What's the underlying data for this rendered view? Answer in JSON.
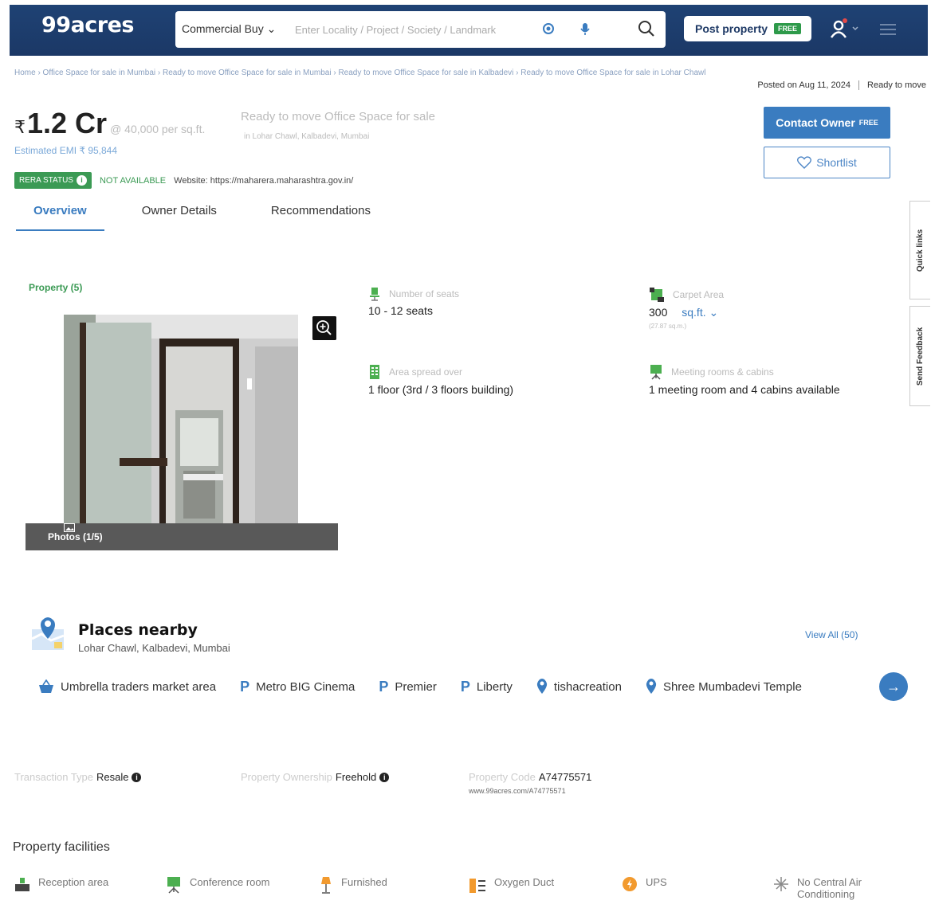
{
  "header": {
    "logo": "99acres",
    "search_category": "Commercial Buy",
    "search_placeholder": "Enter Locality / Project / Society / Landmark",
    "post_property": "Post property",
    "free_badge": "FREE"
  },
  "breadcrumb": "Home › Office Space for sale in Mumbai › Ready to move Office Space for sale in Mumbai › Ready to move Office Space for sale in Kalbadevi › Ready to move Office Space for sale in Lohar Chawl",
  "posted": {
    "date": "Posted on Aug 11, 2024",
    "status": "Ready to move"
  },
  "listing": {
    "currency": "₹",
    "price": "1.2 Cr",
    "per_sqft": "@ 40,000 per sq.ft.",
    "emi": "Estimated EMI ₹ 95,844",
    "title": "Ready to move Office Space for sale",
    "address": "in Lohar Chawl, Kalbadevi, Mumbai",
    "rera_label": "RERA STATUS",
    "rera_value": "NOT AVAILABLE",
    "website": "Website: https://maharera.maharashtra.gov.in/"
  },
  "actions": {
    "contact": "Contact Owner",
    "contact_free": "FREE",
    "shortlist": "Shortlist"
  },
  "tabs": [
    {
      "label": "Overview"
    },
    {
      "label": "Owner Details"
    },
    {
      "label": "Recommendations"
    }
  ],
  "side_tabs": {
    "quick_links": "Quick links",
    "feedback": "Send Feedback"
  },
  "gallery": {
    "count": "Property (5)",
    "photos": "Photos (1/5)"
  },
  "specs": {
    "seats": {
      "label": "Number of seats",
      "value": "10 - 12 seats"
    },
    "carpet": {
      "label": "Carpet Area",
      "value": "300",
      "unit": "sq.ft.",
      "sub": "(27.87 sq.m.)"
    },
    "floors": {
      "label": "Area spread over",
      "value": "1 floor (3rd / 3 floors building)"
    },
    "meeting": {
      "label": "Meeting rooms & cabins",
      "value": "1 meeting room and 4 cabins available"
    }
  },
  "places": {
    "title": "Places nearby",
    "subtitle": "Lohar Chawl, Kalbadevi, Mumbai",
    "view_all": "View All (50)",
    "items": [
      {
        "name": "Umbrella traders market area",
        "icon": "shopping-basket-icon"
      },
      {
        "name": "Metro BIG Cinema",
        "icon": "parking-icon"
      },
      {
        "name": "Premier",
        "icon": "parking-icon"
      },
      {
        "name": "Liberty",
        "icon": "parking-icon"
      },
      {
        "name": "tishacreation",
        "icon": "location-pin-icon"
      },
      {
        "name": "Shree Mumbadevi Temple",
        "icon": "location-pin-icon"
      }
    ]
  },
  "details": {
    "transaction_label": "Transaction Type",
    "transaction_value": "Resale",
    "ownership_label": "Property Ownership",
    "ownership_value": "Freehold",
    "code_label": "Property Code",
    "code_value": "A74775571",
    "code_url": "www.99acres.com/A74775571"
  },
  "facilities": {
    "title": "Property facilities",
    "items": [
      {
        "label": "Reception area",
        "icon": "reception-icon"
      },
      {
        "label": "Conference room",
        "icon": "conference-icon"
      },
      {
        "label": "Furnished",
        "icon": "furnished-icon"
      },
      {
        "label": "Oxygen Duct",
        "icon": "oxygen-duct-icon"
      },
      {
        "label": "UPS",
        "icon": "ups-icon"
      },
      {
        "label": "No Central Air Conditioning",
        "icon": "ac-icon"
      }
    ]
  },
  "colors": {
    "brand": "#1f4274",
    "accent": "#3a7cc0",
    "green": "#3b9a54"
  }
}
